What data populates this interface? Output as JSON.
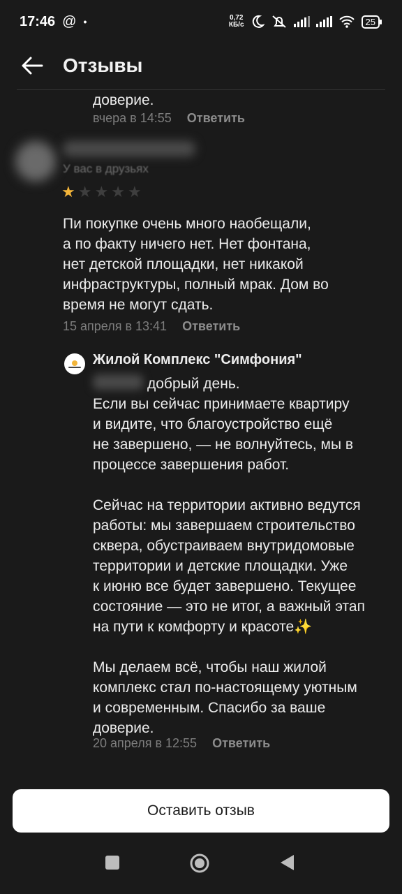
{
  "status_bar": {
    "time": "17:46",
    "notification_glyph": "@",
    "dot": "•",
    "net_speed_value": "0,72",
    "net_speed_unit": "КБ/с",
    "battery": "25",
    "icons": [
      "moon-icon",
      "vibrate-off-icon",
      "signal-icon",
      "signal-icon",
      "wifi-icon",
      "battery-icon"
    ]
  },
  "app_bar": {
    "title": "Отзывы",
    "back_icon": "arrow-left-icon"
  },
  "reviews": [
    {
      "tail_text": "доверие.",
      "date": "вчера в 14:55",
      "reply_label": "Ответить"
    },
    {
      "author_status": "У вас в друзьях",
      "rating": 1,
      "rating_max": 5,
      "text": "Пи покупке очень много наобещали,\nа по факту ничего нет. Нет фонтана,\nнет детской площадки, нет никакой\nинфраструктуры, полный мрак. Дом во\nвремя не могут сдать.",
      "date": "15 апреля в 13:41",
      "reply_label": "Ответить",
      "response": {
        "org_name": "Жилой Комплекс \"Симфония\"",
        "greeting": "добрый день.",
        "body": "Если вы сейчас принимаете квартиру\nи видите, что благоустройство ещё\nне завершено, — не волнуйтесь, мы в\nпроцессе завершения работ.\n\nСейчас на территории активно ведутся\nработы: мы завершаем строительство\nсквера, обустраиваем внутридомовые\nтерритории и детские площадки. Уже\nк июню все будет завершено. Текущее\nсостояние — это не итог, а важный этап\nна пути к комфорту и красоте✨\n\nМы делаем всё, чтобы наш жилой\nкомплекс стал по-настоящему уютным\nи современным. Спасибо за ваше\nдоверие.",
        "date": "20 апреля в 12:55",
        "reply_label": "Ответить"
      }
    }
  ],
  "bottom": {
    "leave_review_label": "Оставить отзыв"
  },
  "nav_bar": {
    "icons": [
      "recent-apps-icon",
      "home-icon",
      "back-triangle-icon"
    ]
  },
  "colors": {
    "background": "#1a1a1a",
    "text": "#ececec",
    "muted": "#7d7d7d",
    "star_on": "#f5b63a",
    "star_off": "#3e3e3e",
    "button_bg": "#ffffff"
  }
}
